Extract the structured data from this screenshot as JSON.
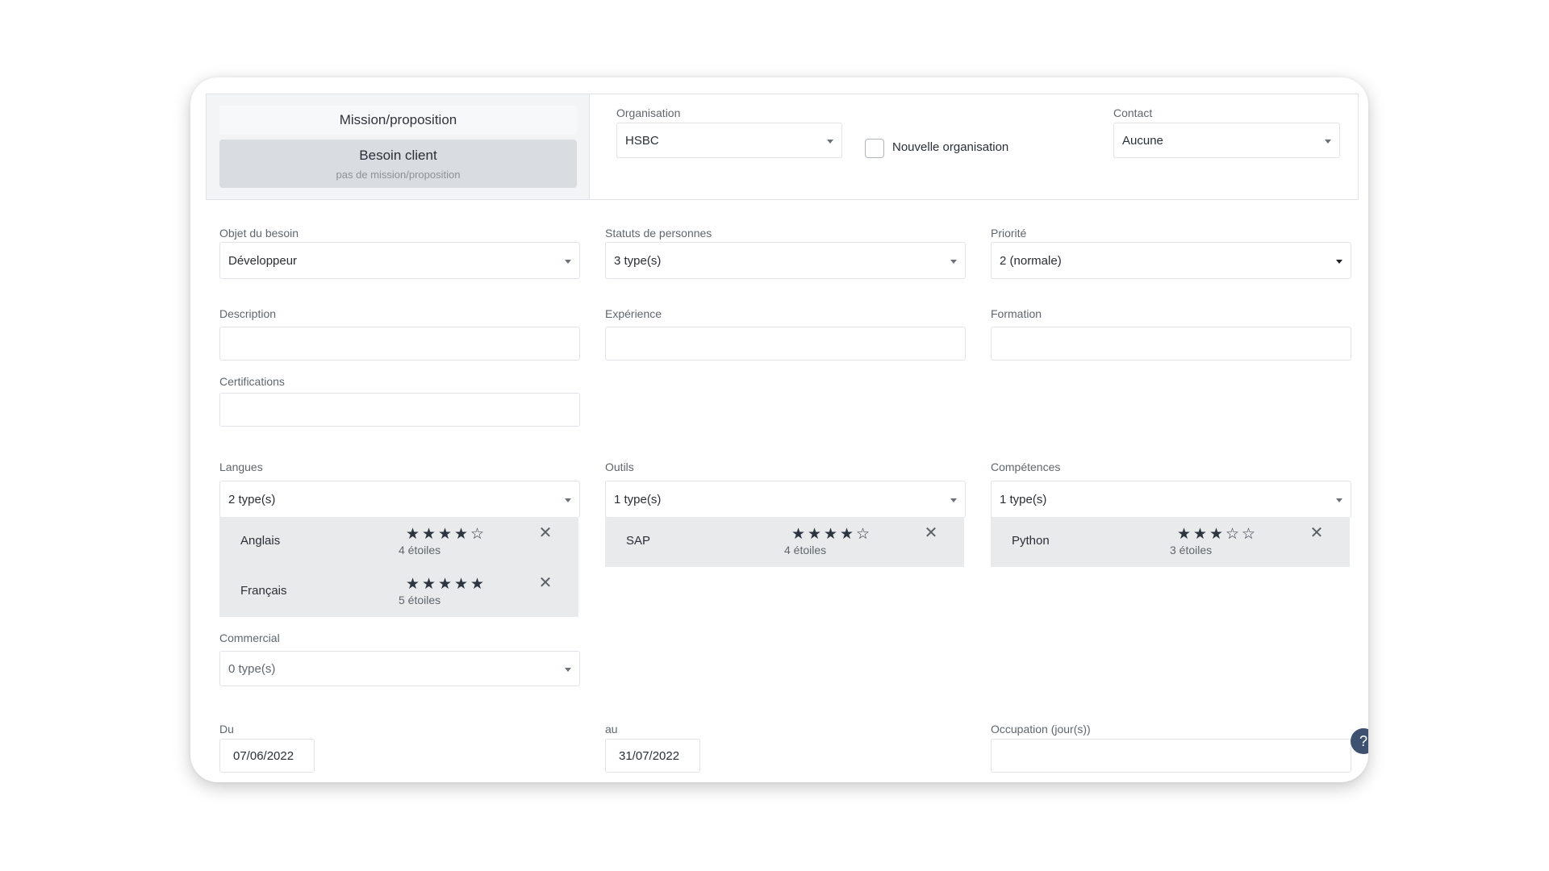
{
  "mode_toggle": {
    "mission_label": "Mission/proposition",
    "besoin_label": "Besoin client",
    "besoin_sub": "pas de mission/proposition"
  },
  "organisation": {
    "label": "Organisation",
    "value": "HSBC"
  },
  "new_org": {
    "label": "Nouvelle organisation",
    "checked": false
  },
  "contact": {
    "label": "Contact",
    "value": "Aucune"
  },
  "objet": {
    "label": "Objet du besoin",
    "value": "Développeur"
  },
  "statuts": {
    "label": "Statuts de personnes",
    "value": "3 type(s)"
  },
  "priorite": {
    "label": "Priorité",
    "value": "2 (normale)"
  },
  "description": {
    "label": "Description",
    "value": ""
  },
  "experience": {
    "label": "Expérience",
    "value": ""
  },
  "formation": {
    "label": "Formation",
    "value": ""
  },
  "certifications": {
    "label": "Certifications",
    "value": ""
  },
  "langues": {
    "label": "Langues",
    "value": "2 type(s)",
    "items": [
      {
        "name": "Anglais",
        "stars": 4,
        "rating_text": "4 étoiles"
      },
      {
        "name": "Français",
        "stars": 5,
        "rating_text": "5 étoiles"
      }
    ]
  },
  "outils": {
    "label": "Outils",
    "value": "1 type(s)",
    "items": [
      {
        "name": "SAP",
        "stars": 4,
        "rating_text": "4 étoiles"
      }
    ]
  },
  "competences": {
    "label": "Compétences",
    "value": "1 type(s)",
    "items": [
      {
        "name": "Python",
        "stars": 3,
        "rating_text": "3 étoiles"
      }
    ]
  },
  "commercial": {
    "label": "Commercial",
    "value": "0 type(s)"
  },
  "du": {
    "label": "Du",
    "value": "07/06/2022"
  },
  "au": {
    "label": "au",
    "value": "31/07/2022"
  },
  "occupation": {
    "label": "Occupation (jour(s))",
    "value": ""
  },
  "icons": {
    "star_filled": "★",
    "star_empty": "☆",
    "close": "✕",
    "help": "?"
  },
  "colors": {
    "selected_toggle": "#d9dde1",
    "tag_bg": "#e8eaec",
    "help_button": "#3f5170"
  }
}
